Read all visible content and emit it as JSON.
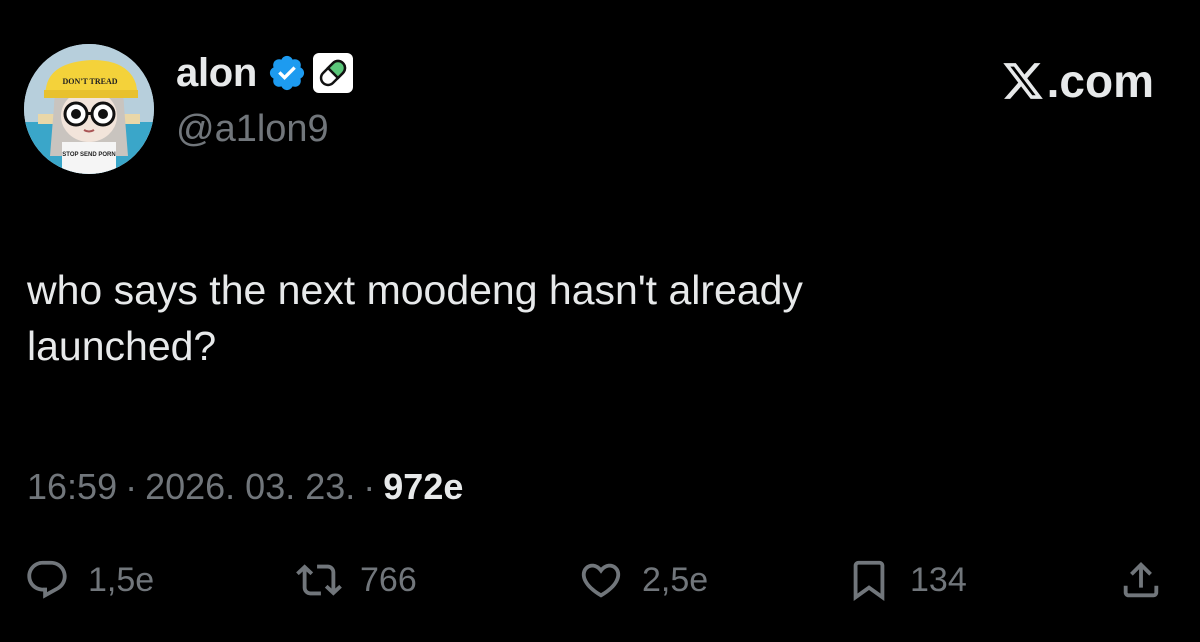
{
  "author": {
    "display_name": "alon",
    "handle": "@a1lon9",
    "avatar_text": {
      "cap": "DON'T TREAD",
      "shirt": "STOP SEND PORN"
    }
  },
  "brand": {
    "label": ".com"
  },
  "tweet": {
    "text": "who says the next moodeng hasn't already\nlaunched?",
    "time": "16:59",
    "date": "2026. 03. 23.",
    "views": "972e"
  },
  "actions": {
    "reply_count": "1,5e",
    "repost_count": "766",
    "like_count": "2,5e",
    "bookmark_count": "134"
  },
  "colors": {
    "background": "#000000",
    "text_primary": "#e7e9ea",
    "text_secondary": "#71767b",
    "verified_blue": "#1d9bf0",
    "pill_green": "#5bc77a"
  },
  "icons": [
    "verified-icon",
    "pill-badge-icon",
    "x-logo-icon",
    "reply-icon",
    "repost-icon",
    "like-icon",
    "bookmark-icon",
    "share-icon"
  ]
}
